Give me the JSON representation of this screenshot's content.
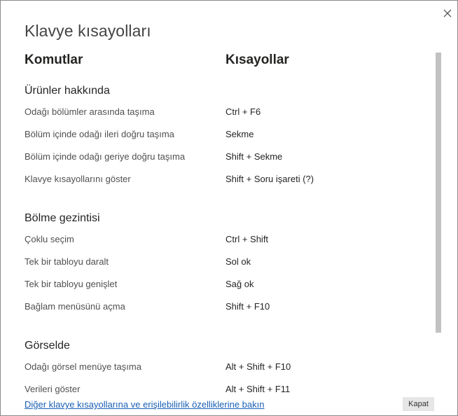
{
  "dialog": {
    "title": "Klavye kısayolları",
    "close_icon": "close-icon"
  },
  "columns": {
    "commands": "Komutlar",
    "shortcuts": "Kısayollar"
  },
  "sections": [
    {
      "title": "Ürünler hakkında",
      "rows": [
        {
          "command": "Odağı bölümler arasında taşıma",
          "shortcut": "Ctrl + F6"
        },
        {
          "command": "Bölüm içinde odağı ileri doğru taşıma",
          "shortcut": "Sekme"
        },
        {
          "command": "Bölüm içinde odağı geriye doğru taşıma",
          "shortcut": "Shift + Sekme"
        },
        {
          "command": "Klavye kısayollarını göster",
          "shortcut": "Shift + Soru işareti (?)"
        }
      ]
    },
    {
      "title": "Bölme gezintisi",
      "rows": [
        {
          "command": "Çoklu seçim",
          "shortcut": "Ctrl + Shift"
        },
        {
          "command": "Tek bir tabloyu daralt",
          "shortcut": "Sol ok"
        },
        {
          "command": "Tek bir tabloyu genişlet",
          "shortcut": "Sağ ok"
        },
        {
          "command": "Bağlam menüsünü açma",
          "shortcut": "Shift + F10"
        }
      ]
    },
    {
      "title": "Görselde",
      "rows": [
        {
          "command": "Odağı görsel menüye taşıma",
          "shortcut": "Alt + Shift + F10"
        },
        {
          "command": "Verileri göster",
          "shortcut": "Alt + Shift + F11"
        }
      ]
    }
  ],
  "footer": {
    "link_text": "Diğer klavye kısayollarına ve erişilebilirlik özelliklerine bakın",
    "close_button_label": "Kapat"
  },
  "colors": {
    "link": "#1a5fb4",
    "scrollbar": "#c2c2c2",
    "button_bg": "#e6e6e6"
  }
}
